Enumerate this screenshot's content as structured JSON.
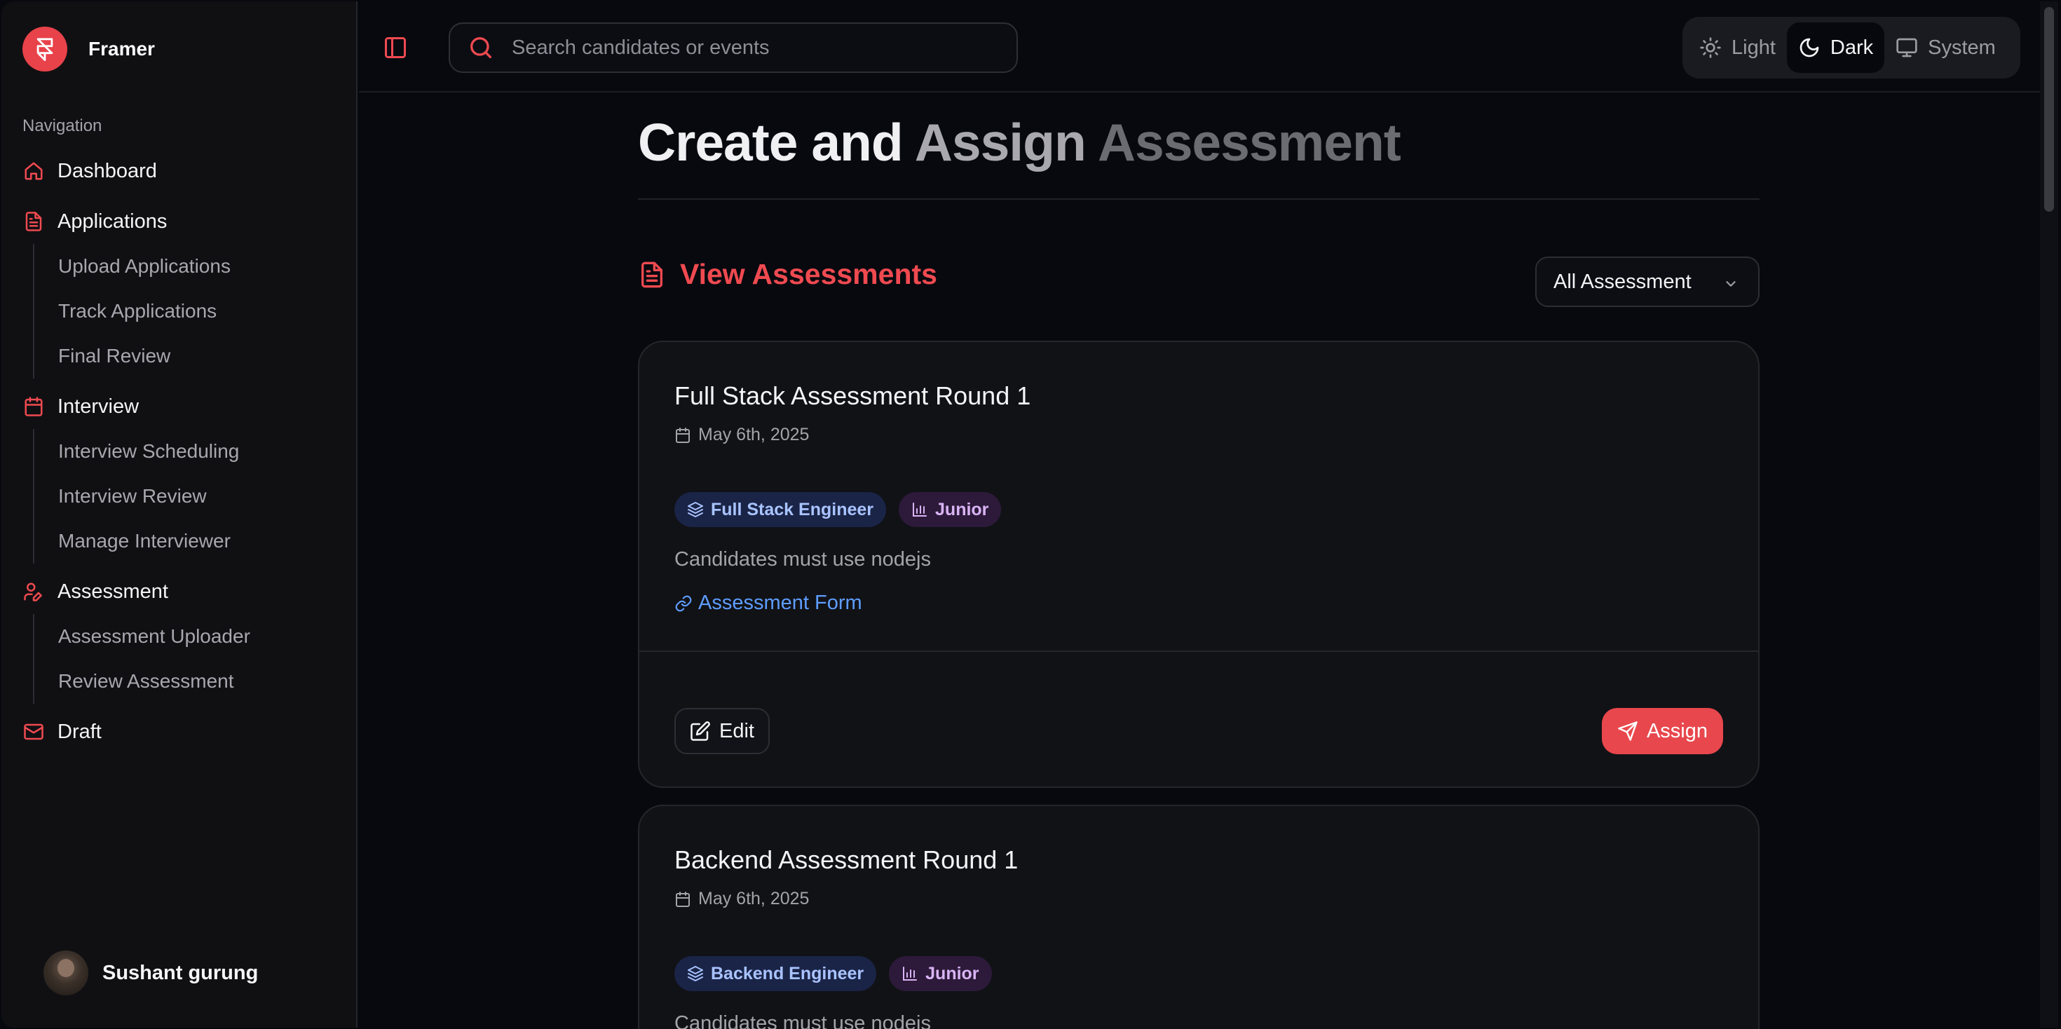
{
  "brand": {
    "name": "Framer"
  },
  "sidebar": {
    "heading": "Navigation",
    "items": [
      {
        "label": "Dashboard",
        "icon": "home-icon"
      },
      {
        "label": "Applications",
        "icon": "document-icon",
        "children": [
          "Upload Applications",
          "Track Applications",
          "Final Review"
        ]
      },
      {
        "label": "Interview",
        "icon": "calendar-icon",
        "children": [
          "Interview Scheduling",
          "Interview Review",
          "Manage Interviewer"
        ]
      },
      {
        "label": "Assessment",
        "icon": "user-pen-icon",
        "children": [
          "Assessment Uploader",
          "Review Assessment"
        ]
      },
      {
        "label": "Draft",
        "icon": "mail-icon"
      }
    ],
    "user": {
      "name": "Sushant gurung"
    }
  },
  "topbar": {
    "search_placeholder": "Search candidates or events",
    "theme": {
      "options": [
        "Light",
        "Dark",
        "System"
      ],
      "selected": "Dark"
    }
  },
  "page": {
    "title_parts": [
      "Create",
      "and",
      "Assign",
      "Assessment"
    ],
    "section_title": "View Assessments",
    "filter_value": "All Assessment"
  },
  "assessments": [
    {
      "title": "Full Stack Assessment Round 1",
      "date": "May 6th, 2025",
      "role": "Full Stack Engineer",
      "level": "Junior",
      "description": "Candidates must use nodejs",
      "link_label": "Assessment Form",
      "edit_label": "Edit",
      "assign_label": "Assign"
    },
    {
      "title": "Backend Assessment Round 1",
      "date": "May 6th, 2025",
      "role": "Backend Engineer",
      "level": "Junior",
      "description": "Candidates must use nodejs"
    }
  ],
  "colors": {
    "accent": "#e8474d",
    "link": "#5e9dff",
    "background": "#07090f",
    "sidebar": "#101013"
  }
}
